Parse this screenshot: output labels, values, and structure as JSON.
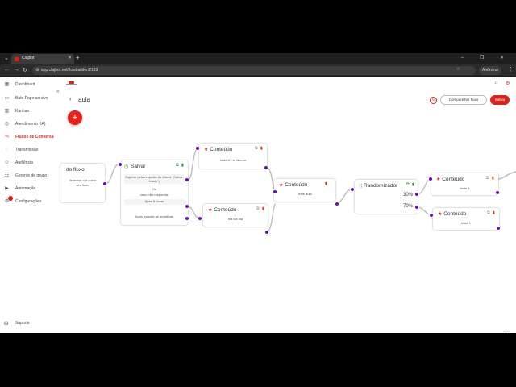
{
  "browser": {
    "tab_title": "Clajbot",
    "url": "app.clajbot.net/flowbuilder/2183",
    "profile": "Anônima",
    "window_controls": "– ❐ ✕"
  },
  "sidebar": {
    "items": [
      {
        "label": "Dashboard",
        "icon": "grid-icon"
      },
      {
        "label": "Bate Papo ao vivo",
        "icon": "chat-icon"
      },
      {
        "label": "Kanban",
        "icon": "kanban-icon"
      },
      {
        "label": "Atendimento (IA)",
        "icon": "robot-icon"
      },
      {
        "label": "Fluxos de Conversa",
        "icon": "flow-icon",
        "active": true
      },
      {
        "label": "Transmissão",
        "icon": "broadcast-icon"
      },
      {
        "label": "Audiência",
        "icon": "people-icon"
      },
      {
        "label": "Gerente de grupo",
        "icon": "group-icon"
      },
      {
        "label": "Automação",
        "icon": "play-icon"
      },
      {
        "label": "Configurações",
        "icon": "gear-icon"
      }
    ],
    "support": "Suporte"
  },
  "header": {
    "flow_name": "aula",
    "share_label": "Compartilhar fluxo",
    "save_label": "Salvar"
  },
  "nodes": {
    "start": {
      "title": "do fluxo",
      "line1": "de entrar o e maior",
      "line2": "seu fluxo"
    },
    "salvar": {
      "title": "Salvar",
      "body": "Esperar pela resposta do cliente (Salvar: Idade )",
      "or": "Ou",
      "no_reply": "caso não responda:",
      "after": "Após 5 horas",
      "after_attempts": "Após esgotar as tentativas"
    },
    "content1": {
      "title": "Conteúdo",
      "text": "Idade21 tá liberdo"
    },
    "content2": {
      "title": "Conteúdo",
      "text": "blá blá blá"
    },
    "content3": {
      "title": "Conteúdo",
      "text": "teste aula"
    },
    "random": {
      "title": "Randomizador",
      "pct_a": "30%",
      "pct_b": "70%"
    },
    "content4": {
      "title": "Conteúdo",
      "text": "teste 1"
    },
    "content5": {
      "title": "Conteúdo",
      "text": "teste 1"
    }
  },
  "footer": {
    "version": "v1.0"
  },
  "colors": {
    "brand": "#d9241c",
    "port": "#6a0dad"
  }
}
